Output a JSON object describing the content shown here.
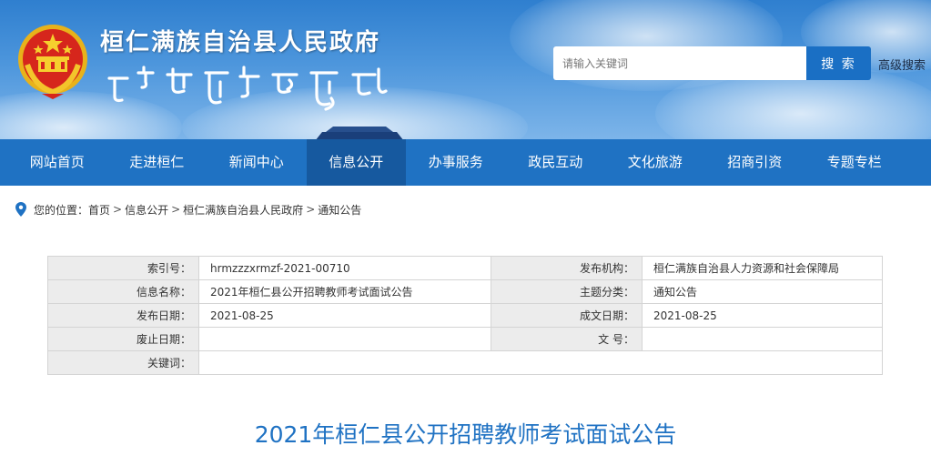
{
  "header": {
    "site_title": "桓仁满族自治县人民政府",
    "search": {
      "placeholder": "请输入关键词",
      "button_label": "搜 索",
      "advanced_label": "高级搜索"
    }
  },
  "nav": {
    "items": [
      {
        "label": "网站首页",
        "active": false
      },
      {
        "label": "走进桓仁",
        "active": false
      },
      {
        "label": "新闻中心",
        "active": false
      },
      {
        "label": "信息公开",
        "active": true
      },
      {
        "label": "办事服务",
        "active": false
      },
      {
        "label": "政民互动",
        "active": false
      },
      {
        "label": "文化旅游",
        "active": false
      },
      {
        "label": "招商引资",
        "active": false
      },
      {
        "label": "专题专栏",
        "active": false
      }
    ]
  },
  "breadcrumb": {
    "prefix": "您的位置：",
    "items": [
      "首页",
      "信息公开",
      "桓仁满族自治县人民政府",
      "通知公告"
    ],
    "separator": ">"
  },
  "info_table": {
    "rows": [
      {
        "l_label": "索引号：",
        "l_value": "hrmzzzxrmzf-2021-00710",
        "r_label": "发布机构：",
        "r_value": "桓仁满族自治县人力资源和社会保障局"
      },
      {
        "l_label": "信息名称：",
        "l_value": "2021年桓仁县公开招聘教师考试面试公告",
        "r_label": "主题分类：",
        "r_value": "通知公告"
      },
      {
        "l_label": "发布日期：",
        "l_value": "2021-08-25",
        "r_label": "成文日期：",
        "r_value": "2021-08-25"
      },
      {
        "l_label": "废止日期：",
        "l_value": "",
        "r_label": "文 号：",
        "r_value": ""
      }
    ],
    "keywords_label": "关键词：",
    "keywords_value": ""
  },
  "article": {
    "title": "2021年桓仁县公开招聘教师考试面试公告"
  },
  "colors": {
    "brand_blue": "#1f72c3",
    "nav_active": "#16599f",
    "title_blue": "#1f72c3"
  },
  "icons": {
    "emblem": "national-emblem-icon",
    "location": "location-pin-icon"
  }
}
